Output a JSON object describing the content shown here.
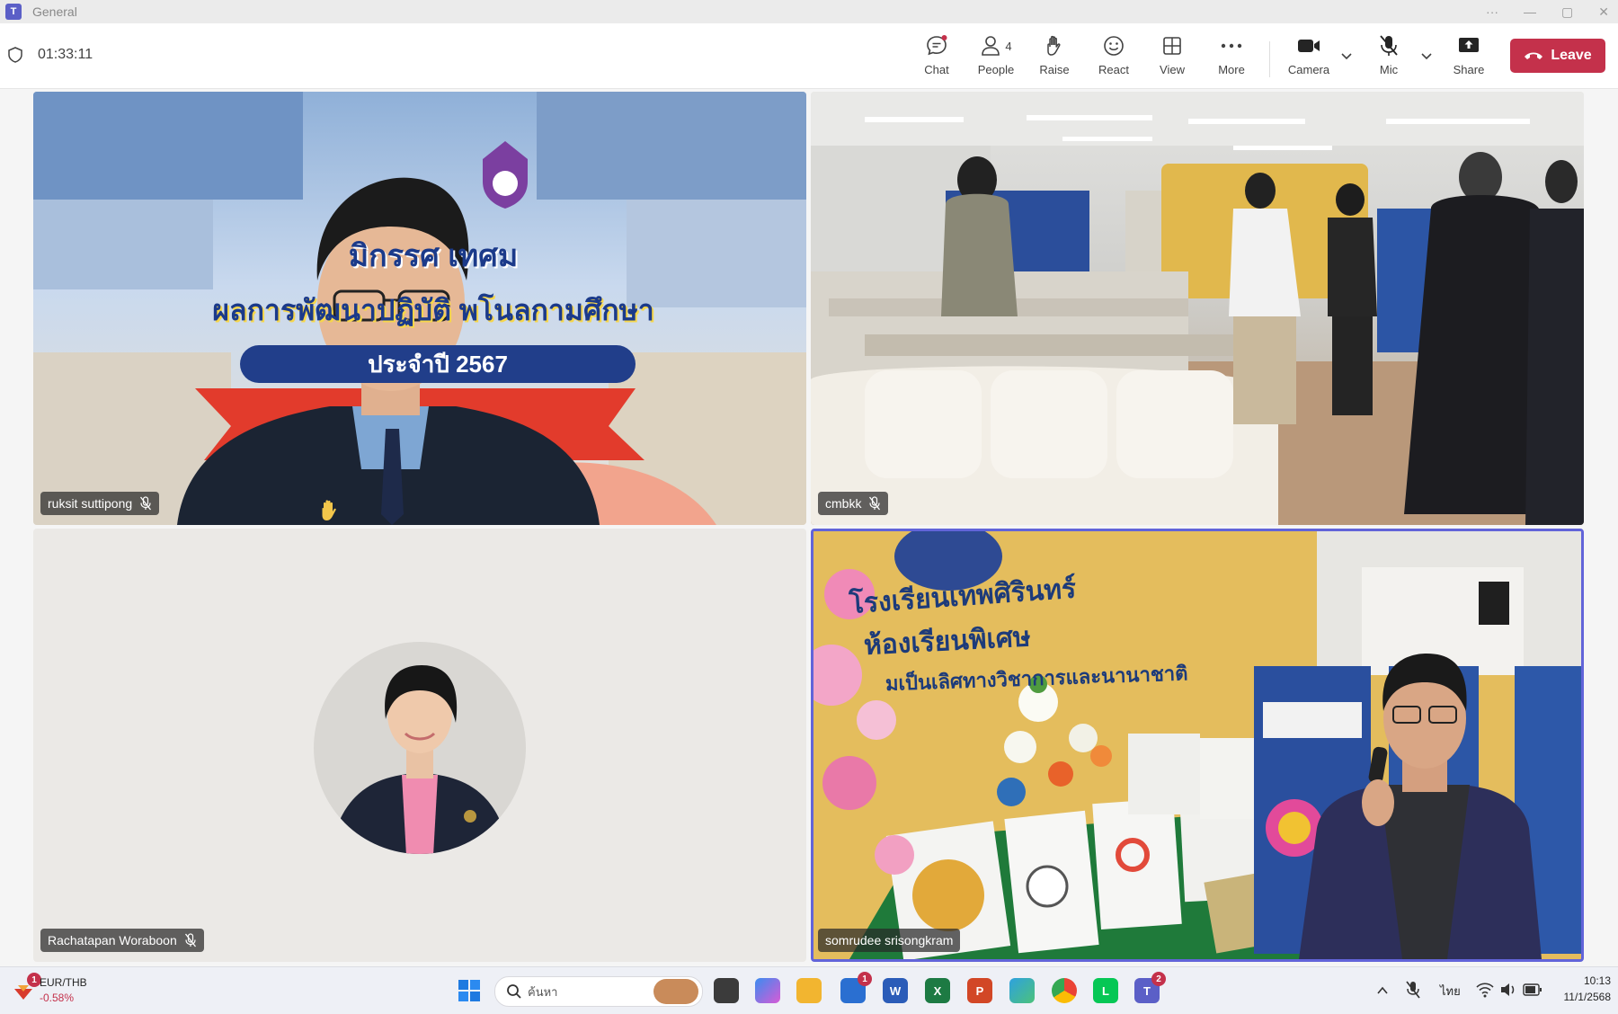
{
  "window": {
    "title": "General"
  },
  "meeting": {
    "timer": "01:33:11"
  },
  "toolbar": {
    "chat": "Chat",
    "people": "People",
    "people_count": "4",
    "raise": "Raise",
    "react": "React",
    "view": "View",
    "more": "More",
    "camera": "Camera",
    "mic": "Mic",
    "share": "Share",
    "leave": "Leave"
  },
  "participants": [
    {
      "name": "ruksit suttipong",
      "muted": true
    },
    {
      "name": "cmbkk",
      "muted": true
    },
    {
      "name": "Rachatapan Woraboon",
      "muted": true
    },
    {
      "name": "somrudee srisongkram",
      "muted": false,
      "active_speaker": true
    }
  ],
  "tile1_banner": {
    "line1": "มิกรรศ เทศม",
    "line2": "ผลการพัฒนาปฏิบัติ พโนลกามศึกษา",
    "line3": "ประจำปี 2567"
  },
  "tile4_banner": {
    "school": "โรงเรียนเทพศิรินทร์",
    "line2": "ห้องเรียนพิเศษ",
    "line3": "มเป็นเลิศทางวิชาการและนานาชาติ"
  },
  "taskbar": {
    "widget_title": "EUR/THB",
    "widget_value": "-0.58%",
    "widget_badge": "1",
    "search_placeholder": "ค้นหา",
    "store_badge": "1",
    "teams_badge": "2",
    "lang": "ไทย",
    "time": "10:13",
    "date": "11/1/2568"
  },
  "colors": {
    "accent": "#5b5fc7",
    "leave": "#c4314b",
    "speaker_border": "#6264d9",
    "widget_negative": "#c4314b"
  }
}
